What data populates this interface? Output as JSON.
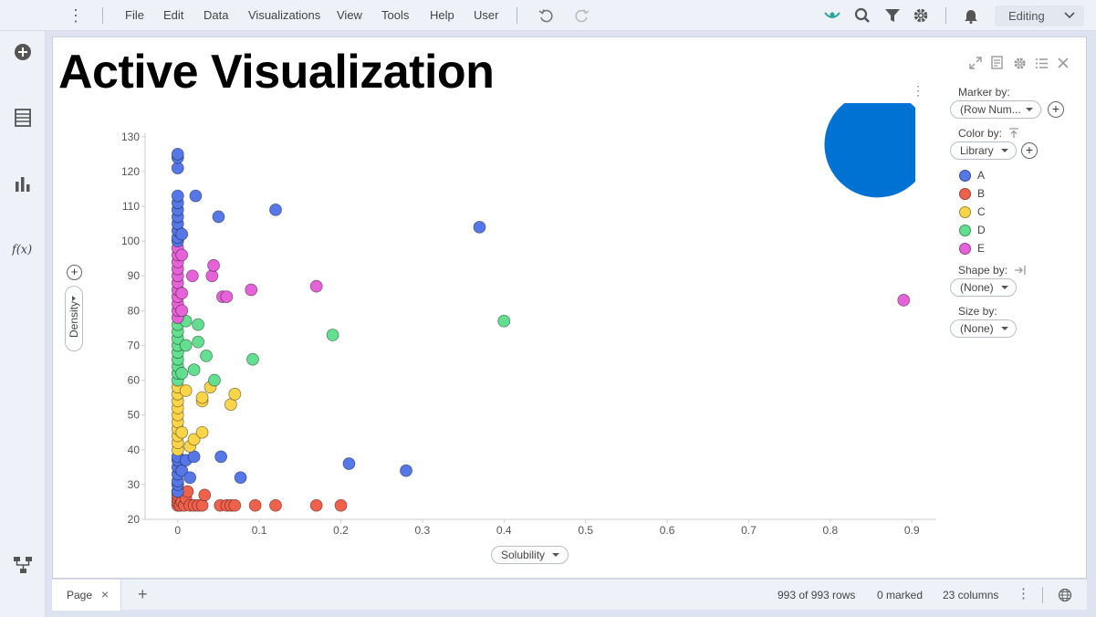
{
  "menu": {
    "items": [
      "File",
      "Edit",
      "Data",
      "Visualizations",
      "View",
      "Tools",
      "Help",
      "User"
    ],
    "mode": "Editing"
  },
  "page": {
    "title": "Active Visualization"
  },
  "legend": {
    "marker_by_label": "Marker by:",
    "marker_by_value": "(Row Num...",
    "color_by_label": "Color by:",
    "color_by_value": "Library",
    "categories": [
      {
        "name": "A",
        "color": "#5577e8"
      },
      {
        "name": "B",
        "color": "#f0614b"
      },
      {
        "name": "C",
        "color": "#fad449"
      },
      {
        "name": "D",
        "color": "#63e08f"
      },
      {
        "name": "E",
        "color": "#e662d8"
      }
    ],
    "shape_by_label": "Shape by:",
    "shape_by_value": "(None)",
    "size_by_label": "Size by:",
    "size_by_value": "(None)"
  },
  "axes": {
    "x_label": "Solubility",
    "y_label": "Density"
  },
  "status": {
    "tab_label": "Page",
    "rows": "993 of 993 rows",
    "marked": "0 marked",
    "columns": "23 columns"
  },
  "colors": {
    "pie": "#0072d4"
  },
  "chart_data": {
    "type": "scatter",
    "xlim": [
      -0.04,
      0.93
    ],
    "ylim": [
      20,
      131
    ],
    "x_ticks": [
      0,
      0.1,
      0.2,
      0.3,
      0.4,
      0.5,
      0.6,
      0.7,
      0.8,
      0.9
    ],
    "x_tick_labels": [
      "0",
      "0.1",
      "0.2",
      "0.3",
      "0.4",
      "0.5",
      "0.6",
      "0.7",
      "0.8",
      "0.9"
    ],
    "y_ticks": [
      20,
      30,
      40,
      50,
      60,
      70,
      80,
      90,
      100,
      110,
      120,
      130
    ],
    "y_tick_labels": [
      "20",
      "30",
      "40",
      "50",
      "60",
      "70",
      "80",
      "90",
      "100",
      "110",
      "120",
      "130"
    ],
    "xlabel": "Solubility",
    "ylabel": "Density",
    "series": [
      {
        "name": "B",
        "color": "#f0614b",
        "points": [
          [
            0,
            24
          ],
          [
            0,
            25
          ],
          [
            0,
            26
          ],
          [
            0,
            27
          ],
          [
            0,
            28
          ],
          [
            0.003,
            24
          ],
          [
            0.005,
            25
          ],
          [
            0.008,
            24
          ],
          [
            0.01,
            26
          ],
          [
            0.012,
            28
          ],
          [
            0.015,
            24
          ],
          [
            0.02,
            24
          ],
          [
            0.025,
            24
          ],
          [
            0.03,
            24
          ],
          [
            0.033,
            27
          ],
          [
            0.052,
            24
          ],
          [
            0.06,
            24
          ],
          [
            0.065,
            24
          ],
          [
            0.07,
            24
          ],
          [
            0.095,
            24
          ],
          [
            0.12,
            24
          ],
          [
            0.17,
            24
          ],
          [
            0.2,
            24
          ]
        ]
      },
      {
        "name": "A",
        "color": "#5577e8",
        "points": [
          [
            0,
            28
          ],
          [
            0,
            30
          ],
          [
            0,
            31
          ],
          [
            0,
            33
          ],
          [
            0,
            35
          ],
          [
            0,
            37
          ],
          [
            0,
            38
          ],
          [
            0.005,
            34
          ],
          [
            0.01,
            37
          ],
          [
            0.015,
            32
          ],
          [
            0.02,
            38
          ],
          [
            0.053,
            38
          ],
          [
            0.077,
            32
          ],
          [
            0.21,
            36
          ],
          [
            0.28,
            34
          ]
        ]
      },
      {
        "name": "C",
        "color": "#fad449",
        "points": [
          [
            0,
            40
          ],
          [
            0,
            42
          ],
          [
            0,
            44
          ],
          [
            0,
            46
          ],
          [
            0,
            48
          ],
          [
            0,
            50
          ],
          [
            0,
            52
          ],
          [
            0,
            54
          ],
          [
            0,
            56
          ],
          [
            0,
            58
          ],
          [
            0.005,
            45
          ],
          [
            0.01,
            57
          ],
          [
            0.015,
            41
          ],
          [
            0.02,
            43
          ],
          [
            0.03,
            45
          ],
          [
            0.03,
            54
          ],
          [
            0.03,
            55
          ],
          [
            0.04,
            58
          ],
          [
            0.065,
            53
          ],
          [
            0.07,
            56
          ]
        ]
      },
      {
        "name": "D",
        "color": "#63e08f",
        "points": [
          [
            0,
            60
          ],
          [
            0,
            62
          ],
          [
            0,
            64
          ],
          [
            0,
            66
          ],
          [
            0,
            68
          ],
          [
            0,
            70
          ],
          [
            0,
            72
          ],
          [
            0,
            74
          ],
          [
            0,
            76
          ],
          [
            0.005,
            62
          ],
          [
            0.01,
            70
          ],
          [
            0.01,
            77
          ],
          [
            0.02,
            63
          ],
          [
            0.025,
            71
          ],
          [
            0.025,
            76
          ],
          [
            0.035,
            67
          ],
          [
            0.045,
            60
          ],
          [
            0.092,
            66
          ],
          [
            0.19,
            73
          ],
          [
            0.4,
            77
          ]
        ]
      },
      {
        "name": "E",
        "color": "#e662d8",
        "points": [
          [
            0,
            78
          ],
          [
            0,
            80
          ],
          [
            0,
            82
          ],
          [
            0,
            84
          ],
          [
            0,
            86
          ],
          [
            0,
            88
          ],
          [
            0,
            90
          ],
          [
            0,
            92
          ],
          [
            0,
            94
          ],
          [
            0,
            96
          ],
          [
            0,
            98
          ],
          [
            0.005,
            80
          ],
          [
            0.005,
            85
          ],
          [
            0.005,
            96
          ],
          [
            0.018,
            90
          ],
          [
            0.042,
            90
          ],
          [
            0.044,
            93
          ],
          [
            0.055,
            84
          ],
          [
            0.06,
            84
          ],
          [
            0.09,
            86
          ],
          [
            0.17,
            87
          ],
          [
            0.89,
            83
          ]
        ]
      },
      {
        "name": "A",
        "color": "#5577e8",
        "points": [
          [
            0,
            100
          ],
          [
            0,
            101
          ],
          [
            0,
            103
          ],
          [
            0,
            105
          ],
          [
            0,
            107
          ],
          [
            0,
            109
          ],
          [
            0,
            111
          ],
          [
            0,
            113
          ],
          [
            0,
            121
          ],
          [
            0,
            124
          ],
          [
            0,
            125
          ],
          [
            0.005,
            102
          ],
          [
            0.022,
            113
          ],
          [
            0.05,
            107
          ],
          [
            0.12,
            109
          ],
          [
            0.37,
            104
          ]
        ]
      }
    ]
  }
}
